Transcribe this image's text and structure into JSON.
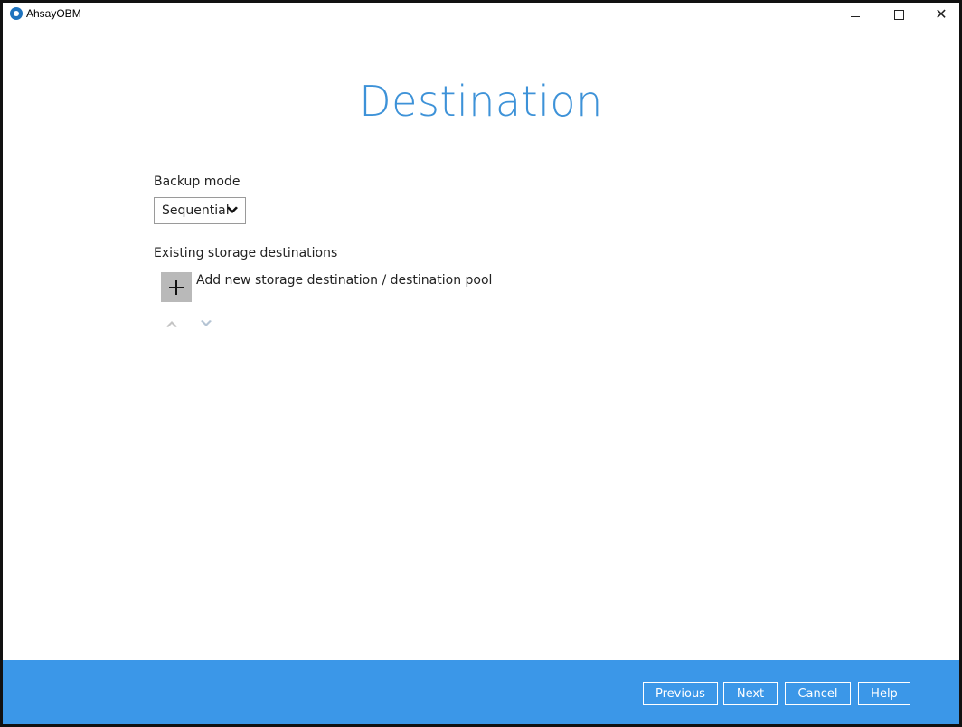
{
  "window": {
    "title": "AhsayOBM",
    "minimize_icon": "minimize-icon",
    "maximize_icon": "maximize-icon",
    "close_icon": "close-icon",
    "close_glyph": "✕"
  },
  "page": {
    "title": "Destination"
  },
  "backup_mode": {
    "label": "Backup mode",
    "selected": "Sequential"
  },
  "storage": {
    "label": "Existing storage destinations",
    "add_label": "Add new storage destination / destination pool"
  },
  "footer": {
    "previous": "Previous",
    "next": "Next",
    "cancel": "Cancel",
    "help": "Help"
  },
  "colors": {
    "accent": "#3d92d8",
    "footer": "#3b97e8",
    "add_button": "#b9b9b9"
  }
}
